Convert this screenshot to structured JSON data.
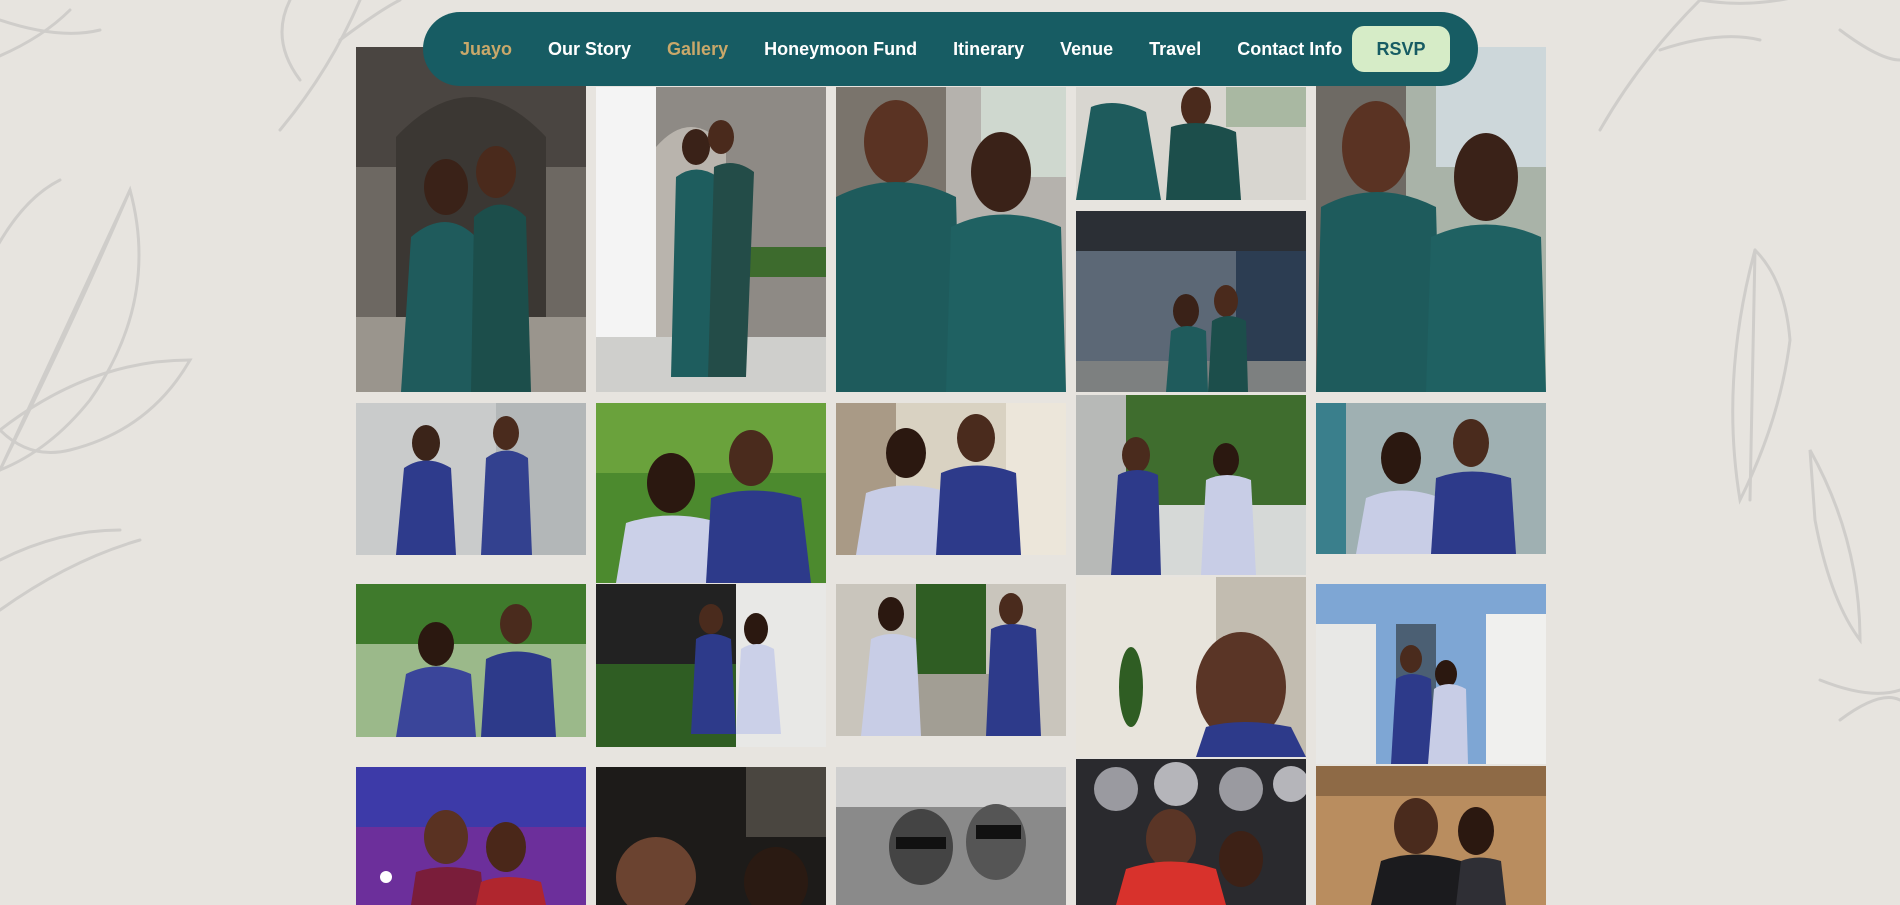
{
  "nav": {
    "brand": "Juayo",
    "items": [
      "Our Story",
      "Gallery",
      "Honeymoon Fund",
      "Itinerary",
      "Venue",
      "Travel",
      "Contact Info"
    ],
    "active": "Gallery",
    "rsvp_label": "RSVP"
  },
  "colors": {
    "nav_bg": "#175c63",
    "accent_gold": "#c9a86a",
    "rsvp_bg": "#d6ecc7",
    "page_bg": "#e7e4df"
  },
  "gallery": {
    "photos": [
      {
        "outfit": "teal",
        "scene": "stone archway"
      },
      {
        "outfit": "teal",
        "scene": "building sidewalk"
      },
      {
        "outfit": "teal",
        "scene": "close-up embrace"
      },
      {
        "outfit": "teal",
        "scene": "street"
      },
      {
        "outfit": "teal",
        "scene": "close-up smile"
      },
      {
        "outfit": "teal",
        "scene": "hotel entrance"
      },
      {
        "outfit": "polka",
        "scene": "tile wall"
      },
      {
        "outfit": "polka",
        "scene": "trees"
      },
      {
        "outfit": "polka",
        "scene": "building"
      },
      {
        "outfit": "polka",
        "scene": "walkway holding hands"
      },
      {
        "outfit": "polka",
        "scene": "patterned wall"
      },
      {
        "outfit": "polka",
        "scene": "park"
      },
      {
        "outfit": "polka",
        "scene": "doorway"
      },
      {
        "outfit": "polka",
        "scene": "planter"
      },
      {
        "outfit": "polka",
        "scene": "portrait profile"
      },
      {
        "outfit": "polka",
        "scene": "skyscraper"
      },
      {
        "outfit": "casual",
        "scene": "club lights"
      },
      {
        "outfit": "casual",
        "scene": "dark selfie"
      },
      {
        "outfit": "casual",
        "scene": "black and white sunglasses"
      },
      {
        "outfit": "casual",
        "scene": "mirrored lights"
      },
      {
        "outfit": "formal",
        "scene": "wood wall event"
      }
    ]
  }
}
